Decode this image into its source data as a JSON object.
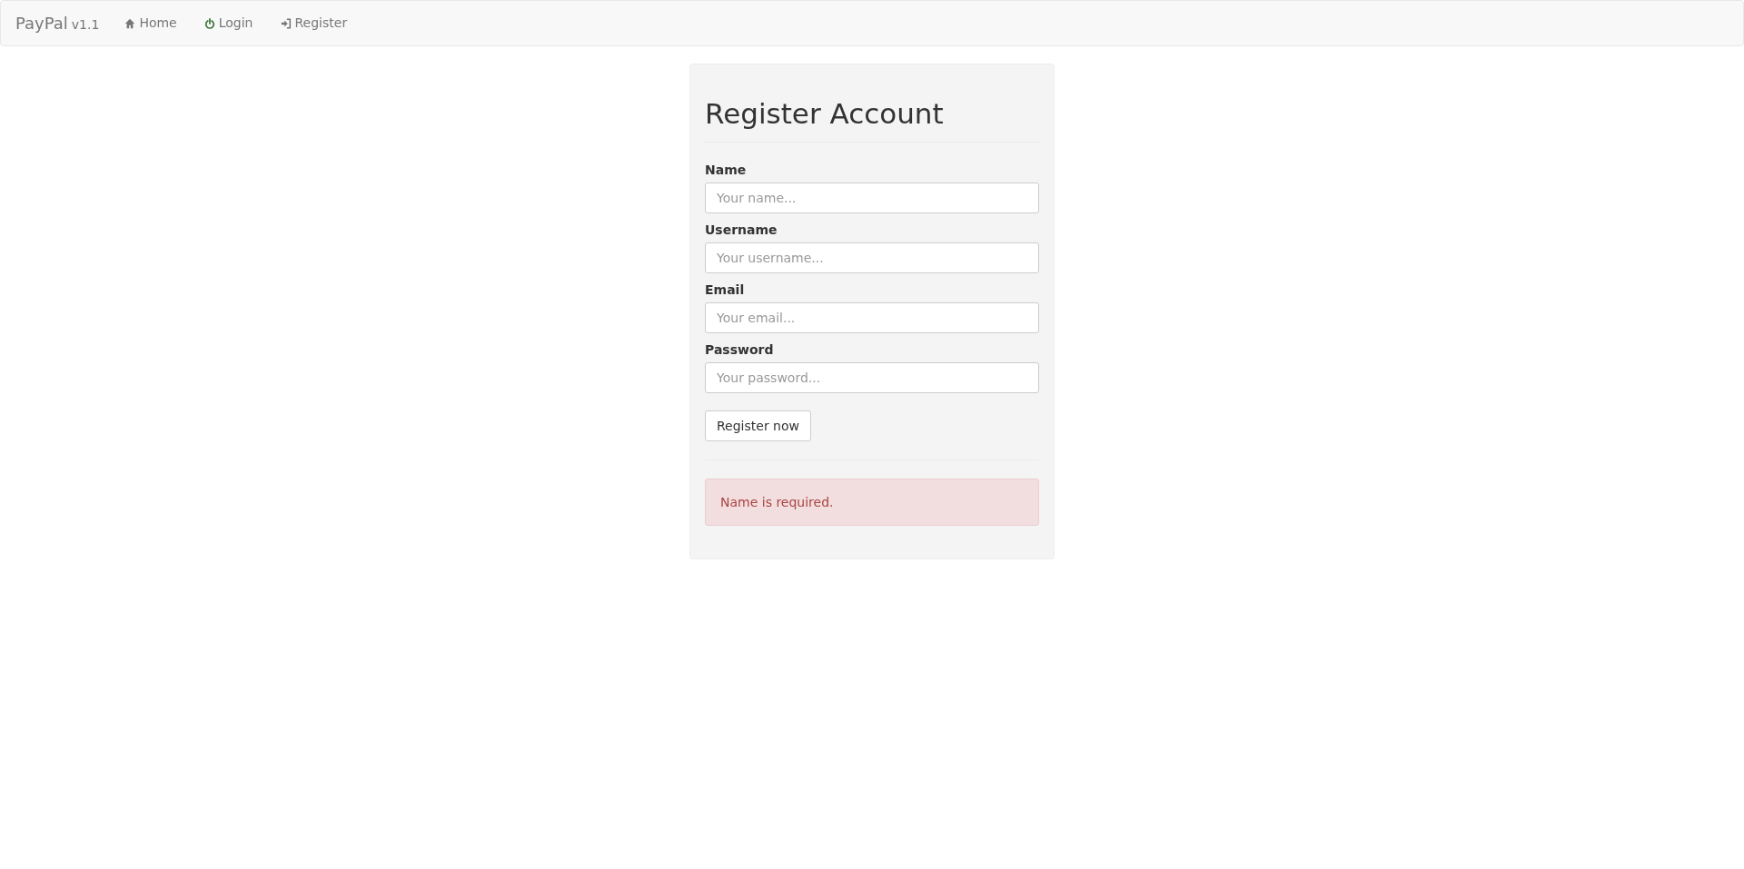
{
  "navbar": {
    "brand": "PayPal",
    "version": "v1.1",
    "links": [
      {
        "label": "Home",
        "kind": "home"
      },
      {
        "label": "Login",
        "kind": "power"
      },
      {
        "label": "Register",
        "kind": "signin"
      }
    ]
  },
  "form": {
    "title": "Register Account",
    "fields": [
      {
        "label": "Name",
        "placeholder": "Your name..."
      },
      {
        "label": "Username",
        "placeholder": "Your username..."
      },
      {
        "label": "Email",
        "placeholder": "Your email..."
      },
      {
        "label": "Password",
        "placeholder": "Your password..."
      }
    ],
    "submit": "Register now",
    "alert": "Name is required."
  }
}
